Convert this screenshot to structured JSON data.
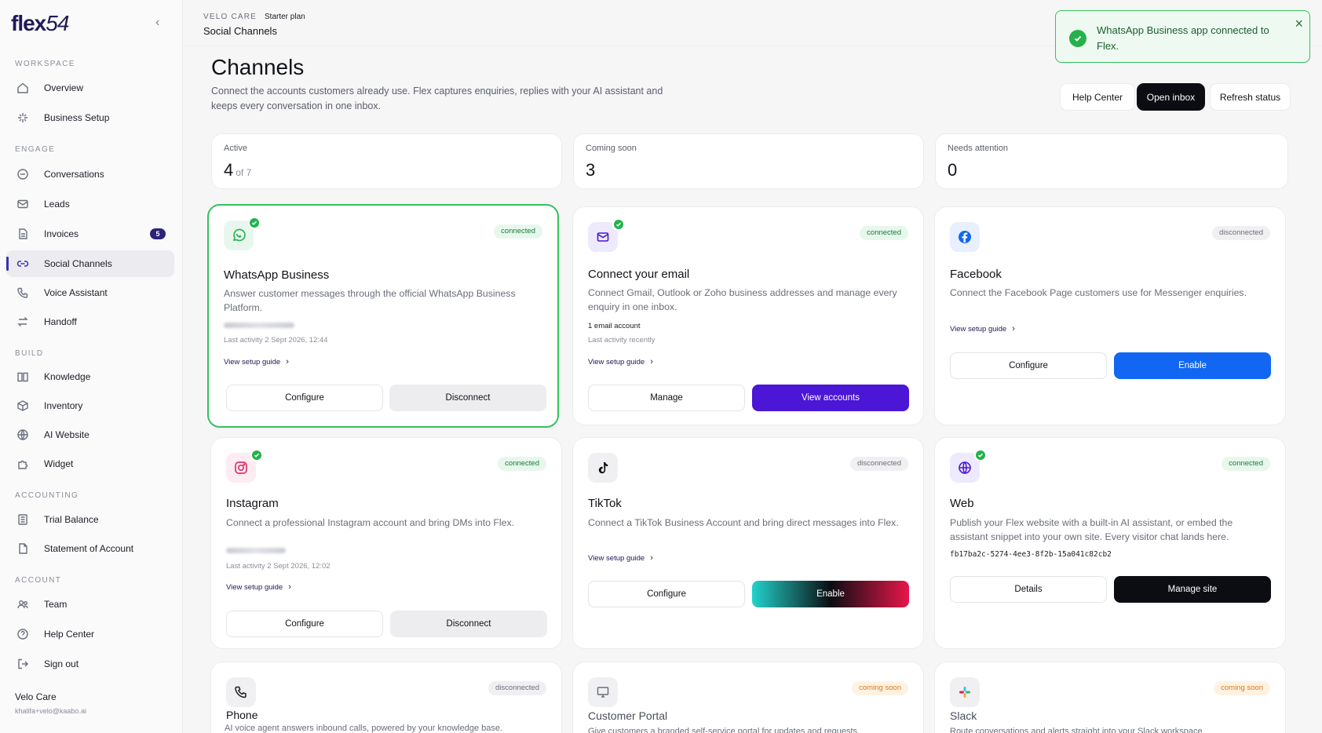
{
  "app": {
    "logo": "flex",
    "logo_num": "54"
  },
  "sidebar": {
    "sections": [
      {
        "label": "WORKSPACE",
        "items": [
          {
            "label": "Overview",
            "icon": "home-icon"
          },
          {
            "label": "Business Setup",
            "icon": "sparkle-icon"
          }
        ]
      },
      {
        "label": "ENGAGE",
        "items": [
          {
            "label": "Conversations",
            "icon": "chat-icon"
          },
          {
            "label": "Leads",
            "icon": "mail-icon"
          },
          {
            "label": "Invoices",
            "icon": "document-icon",
            "badge": "5"
          },
          {
            "label": "Social Channels",
            "icon": "link-icon",
            "active": true
          },
          {
            "label": "Voice Assistant",
            "icon": "phone-icon"
          },
          {
            "label": "Handoff",
            "icon": "swap-icon"
          }
        ]
      },
      {
        "label": "BUILD",
        "items": [
          {
            "label": "Knowledge",
            "icon": "book-icon"
          },
          {
            "label": "Inventory",
            "icon": "box-icon"
          },
          {
            "label": "AI Website",
            "icon": "globe-icon"
          },
          {
            "label": "Widget",
            "icon": "puzzle-icon"
          }
        ]
      },
      {
        "label": "ACCOUNTING",
        "items": [
          {
            "label": "Trial Balance",
            "icon": "ledger-icon"
          },
          {
            "label": "Statement of Account",
            "icon": "file-icon"
          }
        ]
      },
      {
        "label": "ACCOUNT",
        "items": [
          {
            "label": "Team",
            "icon": "team-icon"
          },
          {
            "label": "Help Center",
            "icon": "help-icon"
          },
          {
            "label": "Sign out",
            "icon": "signout-icon"
          }
        ]
      }
    ],
    "user": {
      "name": "Velo Care",
      "email": "khalifa+velo@kaabo.ai"
    }
  },
  "header": {
    "org": "VELO CARE",
    "plan": "Starter plan",
    "page": "Social Channels"
  },
  "toast": {
    "message": "WhatsApp Business app connected to Flex."
  },
  "page": {
    "title": "Channels",
    "description": "Connect the accounts customers already use. Flex captures enquiries, replies with your AI assistant and keeps every conversation in one inbox.",
    "buttons": {
      "help": "Help Center",
      "inbox": "Open inbox",
      "refresh": "Refresh status"
    }
  },
  "stats": [
    {
      "label": "Active",
      "value": "4",
      "suffix": "of 7"
    },
    {
      "label": "Coming soon",
      "value": "3"
    },
    {
      "label": "Needs attention",
      "value": "0"
    }
  ],
  "channels": [
    {
      "title": "WhatsApp Business",
      "status": "connected",
      "description": "Answer customer messages through the official WhatsApp Business Platform.",
      "meta": "Last activity 2 Sept 2026, 12:44",
      "guide": "View setup guide",
      "btn1": "Configure",
      "btn2": "Disconnect"
    },
    {
      "title": "Connect your email",
      "status": "connected",
      "description": "Connect Gmail, Outlook or Zoho business addresses and manage every enquiry in one inbox.",
      "meta_account": "1 email account",
      "meta": "Last activity recently",
      "guide": "View setup guide",
      "btn1": "Manage",
      "btn2": "View accounts"
    },
    {
      "title": "Facebook",
      "status": "disconnected",
      "description": "Connect the Facebook Page customers use for Messenger enquiries.",
      "guide": "View setup guide",
      "btn1": "Configure",
      "btn2": "Enable"
    },
    {
      "title": "Instagram",
      "status": "connected",
      "description": "Connect a professional Instagram account and bring DMs into Flex.",
      "meta": "Last activity 2 Sept 2026, 12:02",
      "guide": "View setup guide",
      "btn1": "Configure",
      "btn2": "Disconnect"
    },
    {
      "title": "TikTok",
      "status": "disconnected",
      "description": "Connect a TikTok Business Account and bring direct messages into Flex.",
      "guide": "View setup guide",
      "btn1": "Configure",
      "btn2": "Enable"
    },
    {
      "title": "Web",
      "status": "connected",
      "description": "Publish your Flex website with a built-in AI assistant, or embed the assistant snippet into your own site. Every visitor chat lands here.",
      "id": "fb17ba2c-5274-4ee3-8f2b-15a041c82cb2",
      "btn1": "Details",
      "btn2": "Manage site"
    },
    {
      "title": "Phone",
      "status": "disconnected",
      "description": "AI voice agent answers inbound calls, powered by your knowledge base."
    },
    {
      "title": "Customer Portal",
      "status": "coming soon",
      "description": "Give customers a branded self-service portal for updates and requests."
    },
    {
      "title": "Slack",
      "status": "coming soon",
      "description": "Route conversations and alerts straight into your Slack workspace."
    }
  ],
  "colors": {
    "accent": "#4b16d6",
    "brand": "#1f1a55",
    "success": "#35c15d",
    "facebook": "#1167f2"
  }
}
